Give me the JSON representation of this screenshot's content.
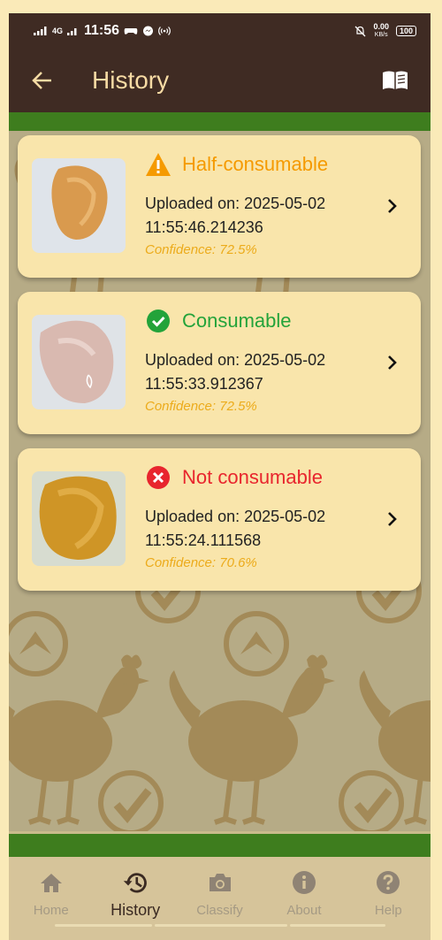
{
  "status_bar": {
    "network": "4G",
    "time": "11:56",
    "speed": "0.00",
    "speed_unit": "KB/s",
    "battery": "100"
  },
  "header": {
    "title": "History"
  },
  "history": [
    {
      "status": "Half-consumable",
      "status_icon": "warning-icon",
      "status_color": "#f59a00",
      "uploaded_line1": "Uploaded on: 2025-05-02",
      "uploaded_line2": "11:55:46.214236",
      "confidence": "Confidence: 72.5%"
    },
    {
      "status": "Consumable",
      "status_icon": "check-circle-icon",
      "status_color": "#23a33a",
      "uploaded_line1": "Uploaded on: 2025-05-02",
      "uploaded_line2": "11:55:33.912367",
      "confidence": "Confidence: 72.5%"
    },
    {
      "status": "Not consumable",
      "status_icon": "x-circle-icon",
      "status_color": "#e8252d",
      "uploaded_line1": "Uploaded on: 2025-05-02",
      "uploaded_line2": "11:55:24.111568",
      "confidence": "Confidence: 70.6%"
    }
  ],
  "bottom_nav": [
    {
      "label": "Home",
      "icon": "home-icon",
      "active": false
    },
    {
      "label": "History",
      "icon": "history-icon",
      "active": true
    },
    {
      "label": "Classify",
      "icon": "camera-icon",
      "active": false
    },
    {
      "label": "About",
      "icon": "info-icon",
      "active": false
    },
    {
      "label": "Help",
      "icon": "help-icon",
      "active": false
    }
  ],
  "colors": {
    "appbar": "#3f2b23",
    "title": "#f7dba4",
    "accent_green": "#3e7d1e",
    "card": "#f9e5ab",
    "confidence": "#ecab1b"
  }
}
